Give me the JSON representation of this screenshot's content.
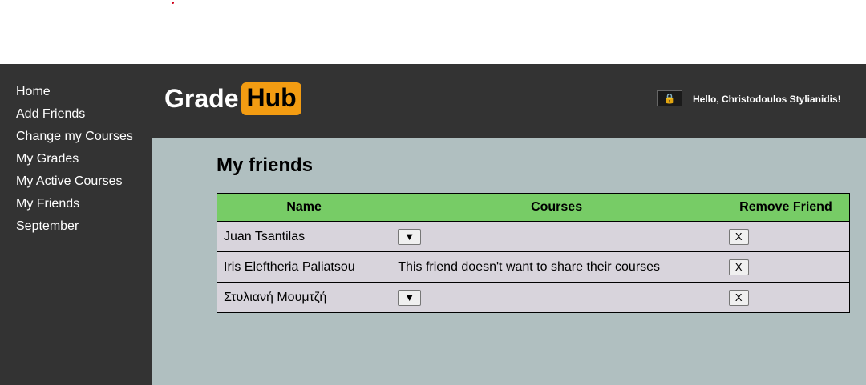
{
  "sidebar": {
    "items": [
      {
        "label": "Home"
      },
      {
        "label": "Add Friends"
      },
      {
        "label": "Change my Courses"
      },
      {
        "label": "My Grades"
      },
      {
        "label": "My Active Courses"
      },
      {
        "label": "My Friends"
      },
      {
        "label": "September"
      }
    ]
  },
  "header": {
    "logo_text": "Grade",
    "logo_badge": "Hub",
    "lock_icon": "🔒",
    "greeting": "Hello, Christodoulos Stylianidis!"
  },
  "main": {
    "title": "My friends",
    "table": {
      "headers": [
        "Name",
        "Courses",
        "Remove Friend"
      ],
      "rows": [
        {
          "name": "Juan Tsantilas",
          "courses_button": "▼",
          "courses_text": "",
          "remove_label": "X"
        },
        {
          "name": "Iris Eleftheria Paliatsou",
          "courses_button": "",
          "courses_text": "This friend doesn't want to share their courses",
          "remove_label": "X"
        },
        {
          "name": "Στυλιανή Μουμτζή",
          "courses_button": "▼",
          "courses_text": "",
          "remove_label": "X"
        }
      ]
    }
  },
  "colors": {
    "sidebar_bg": "#333333",
    "main_bg": "#b0bfc0",
    "header_row_bg": "#77cc66",
    "row_bg": "#d8d4dc",
    "logo_accent": "#f39c12"
  },
  "icons": {
    "lock": "lock-icon",
    "expand": "chevron-down-icon",
    "remove": "close-icon"
  }
}
